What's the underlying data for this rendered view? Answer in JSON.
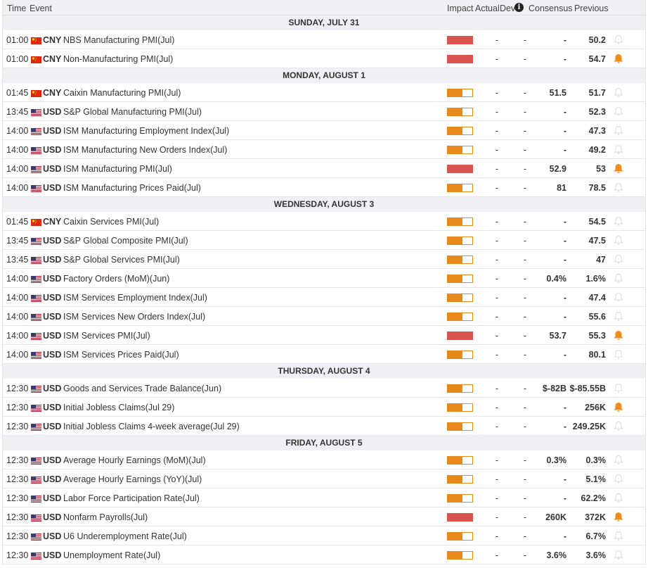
{
  "header": {
    "time": "Time",
    "event": "Event",
    "impact": "Impact",
    "actual": "Actual",
    "dev": "Dev",
    "info": "i",
    "consensus": "Consensus",
    "previous": "Previous"
  },
  "colors": {
    "high": "#d9534f",
    "medium": "#e8891c",
    "bell_on": "#f08c1a",
    "bell_off": "#d8d8d8"
  },
  "groups": [
    {
      "date": "SUNDAY, JULY 31",
      "events": [
        {
          "time": "01:00",
          "cur": "CNY",
          "event": "NBS Manufacturing PMI(Jul)",
          "impact": "high",
          "actual": "-",
          "dev": "-",
          "consensus": "-",
          "previous": "50.2",
          "alert": false
        },
        {
          "time": "01:00",
          "cur": "CNY",
          "event": "Non-Manufacturing PMI(Jul)",
          "impact": "high",
          "actual": "-",
          "dev": "-",
          "consensus": "-",
          "previous": "54.7",
          "alert": true
        }
      ]
    },
    {
      "date": "MONDAY, AUGUST 1",
      "events": [
        {
          "time": "01:45",
          "cur": "CNY",
          "event": "Caixin Manufacturing PMI(Jul)",
          "impact": "medium",
          "actual": "-",
          "dev": "-",
          "consensus": "51.5",
          "previous": "51.7",
          "alert": false
        },
        {
          "time": "13:45",
          "cur": "USD",
          "event": "S&P Global Manufacturing PMI(Jul)",
          "impact": "medium",
          "actual": "-",
          "dev": "-",
          "consensus": "-",
          "previous": "52.3",
          "alert": false
        },
        {
          "time": "14:00",
          "cur": "USD",
          "event": "ISM Manufacturing Employment Index(Jul)",
          "impact": "medium",
          "actual": "-",
          "dev": "-",
          "consensus": "-",
          "previous": "47.3",
          "alert": false
        },
        {
          "time": "14:00",
          "cur": "USD",
          "event": "ISM Manufacturing New Orders Index(Jul)",
          "impact": "medium",
          "actual": "-",
          "dev": "-",
          "consensus": "-",
          "previous": "49.2",
          "alert": false
        },
        {
          "time": "14:00",
          "cur": "USD",
          "event": "ISM Manufacturing PMI(Jul)",
          "impact": "high",
          "actual": "-",
          "dev": "-",
          "consensus": "52.9",
          "previous": "53",
          "alert": true
        },
        {
          "time": "14:00",
          "cur": "USD",
          "event": "ISM Manufacturing Prices Paid(Jul)",
          "impact": "medium",
          "actual": "-",
          "dev": "-",
          "consensus": "81",
          "previous": "78.5",
          "alert": false
        }
      ]
    },
    {
      "date": "WEDNESDAY, AUGUST 3",
      "events": [
        {
          "time": "01:45",
          "cur": "CNY",
          "event": "Caixin Services PMI(Jul)",
          "impact": "medium",
          "actual": "-",
          "dev": "-",
          "consensus": "-",
          "previous": "54.5",
          "alert": false
        },
        {
          "time": "13:45",
          "cur": "USD",
          "event": "S&P Global Composite PMI(Jul)",
          "impact": "medium",
          "actual": "-",
          "dev": "-",
          "consensus": "-",
          "previous": "47.5",
          "alert": false
        },
        {
          "time": "13:45",
          "cur": "USD",
          "event": "S&P Global Services PMI(Jul)",
          "impact": "medium",
          "actual": "-",
          "dev": "-",
          "consensus": "-",
          "previous": "47",
          "alert": false
        },
        {
          "time": "14:00",
          "cur": "USD",
          "event": "Factory Orders (MoM)(Jun)",
          "impact": "medium",
          "actual": "-",
          "dev": "-",
          "consensus": "0.4%",
          "previous": "1.6%",
          "alert": false
        },
        {
          "time": "14:00",
          "cur": "USD",
          "event": "ISM Services Employment Index(Jul)",
          "impact": "medium",
          "actual": "-",
          "dev": "-",
          "consensus": "-",
          "previous": "47.4",
          "alert": false
        },
        {
          "time": "14:00",
          "cur": "USD",
          "event": "ISM Services New Orders Index(Jul)",
          "impact": "medium",
          "actual": "-",
          "dev": "-",
          "consensus": "-",
          "previous": "55.6",
          "alert": false
        },
        {
          "time": "14:00",
          "cur": "USD",
          "event": "ISM Services PMI(Jul)",
          "impact": "high",
          "actual": "-",
          "dev": "-",
          "consensus": "53.7",
          "previous": "55.3",
          "alert": true
        },
        {
          "time": "14:00",
          "cur": "USD",
          "event": "ISM Services Prices Paid(Jul)",
          "impact": "medium",
          "actual": "-",
          "dev": "-",
          "consensus": "-",
          "previous": "80.1",
          "alert": false
        }
      ]
    },
    {
      "date": "THURSDAY, AUGUST 4",
      "events": [
        {
          "time": "12:30",
          "cur": "USD",
          "event": "Goods and Services Trade Balance(Jun)",
          "impact": "medium",
          "actual": "-",
          "dev": "-",
          "consensus": "$-82B",
          "previous": "$-85.55B",
          "alert": false
        },
        {
          "time": "12:30",
          "cur": "USD",
          "event": "Initial Jobless Claims(Jul 29)",
          "impact": "medium",
          "actual": "-",
          "dev": "-",
          "consensus": "-",
          "previous": "256K",
          "alert": true
        },
        {
          "time": "12:30",
          "cur": "USD",
          "event": "Initial Jobless Claims 4-week average(Jul 29)",
          "impact": "medium",
          "actual": "-",
          "dev": "-",
          "consensus": "-",
          "previous": "249.25K",
          "alert": false
        }
      ]
    },
    {
      "date": "FRIDAY, AUGUST 5",
      "events": [
        {
          "time": "12:30",
          "cur": "USD",
          "event": "Average Hourly Earnings (MoM)(Jul)",
          "impact": "medium",
          "actual": "-",
          "dev": "-",
          "consensus": "0.3%",
          "previous": "0.3%",
          "alert": false
        },
        {
          "time": "12:30",
          "cur": "USD",
          "event": "Average Hourly Earnings (YoY)(Jul)",
          "impact": "medium",
          "actual": "-",
          "dev": "-",
          "consensus": "-",
          "previous": "5.1%",
          "alert": false
        },
        {
          "time": "12:30",
          "cur": "USD",
          "event": "Labor Force Participation Rate(Jul)",
          "impact": "medium",
          "actual": "-",
          "dev": "-",
          "consensus": "-",
          "previous": "62.2%",
          "alert": false
        },
        {
          "time": "12:30",
          "cur": "USD",
          "event": "Nonfarm Payrolls(Jul)",
          "impact": "high",
          "actual": "-",
          "dev": "-",
          "consensus": "260K",
          "previous": "372K",
          "alert": true
        },
        {
          "time": "12:30",
          "cur": "USD",
          "event": "U6 Underemployment Rate(Jul)",
          "impact": "medium",
          "actual": "-",
          "dev": "-",
          "consensus": "-",
          "previous": "6.7%",
          "alert": false
        },
        {
          "time": "12:30",
          "cur": "USD",
          "event": "Unemployment Rate(Jul)",
          "impact": "medium",
          "actual": "-",
          "dev": "-",
          "consensus": "3.6%",
          "previous": "3.6%",
          "alert": false
        }
      ]
    }
  ]
}
